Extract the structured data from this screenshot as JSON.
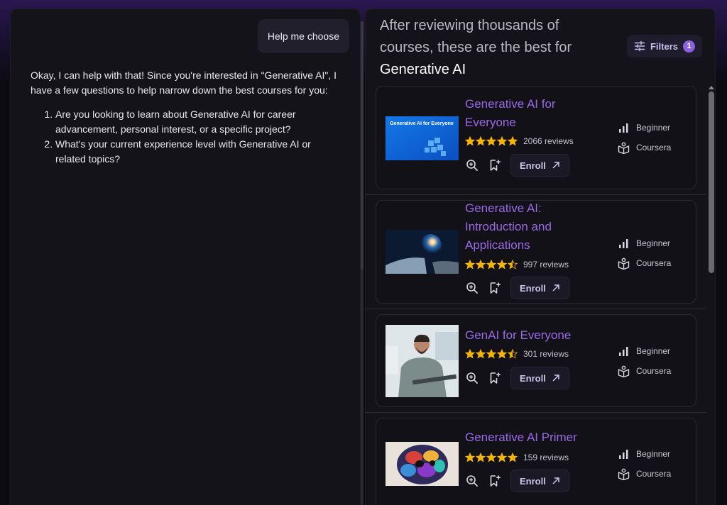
{
  "chat": {
    "user_message": "Help me choose",
    "assistant_intro": "Okay, I can help with that! Since you're interested in \"Generative AI\", I have a few questions to help narrow down the best courses for you:",
    "questions": [
      "Are you looking to learn about Generative AI for career advancement, personal interest, or a specific project?",
      "What's your current experience level with Generative AI or related topics?"
    ]
  },
  "results": {
    "header_prefix": "After reviewing thousands of courses, these are the best for",
    "header_topic": "Generative AI",
    "filters_label": "Filters",
    "filters_count": "1",
    "courses": [
      {
        "title": "Generative AI for Everyone",
        "rating": 5,
        "reviews": "2066 reviews",
        "level": "Beginner",
        "provider": "Coursera",
        "enroll_label": "Enroll",
        "thumb_text": "Generative AI for Everyone"
      },
      {
        "title": "Generative AI: Introduction and Applications",
        "rating": 4.5,
        "reviews": "997 reviews",
        "level": "Beginner",
        "provider": "Coursera",
        "enroll_label": "Enroll"
      },
      {
        "title": "GenAI for Everyone",
        "rating": 4.5,
        "reviews": "301 reviews",
        "level": "Beginner",
        "provider": "Coursera",
        "enroll_label": "Enroll"
      },
      {
        "title": "Generative AI Primer",
        "rating": 5,
        "reviews": "159 reviews",
        "level": "Beginner",
        "provider": "Coursera",
        "enroll_label": "Enroll"
      }
    ]
  },
  "colors": {
    "accent": "#9a6ae6",
    "star": "#f5b400",
    "badge": "#8a62e0"
  }
}
